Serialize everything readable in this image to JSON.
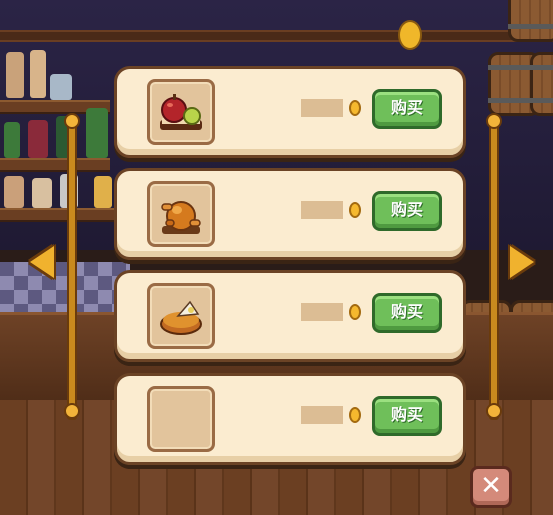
{
  "shop": {
    "items": [
      {
        "icon": "apple-basket-icon",
        "buy_label": "购买"
      },
      {
        "icon": "roast-chicken-icon",
        "buy_label": "购买"
      },
      {
        "icon": "pie-icon",
        "buy_label": "购买"
      },
      {
        "icon": "empty-slot-icon",
        "buy_label": "购买"
      }
    ],
    "close_label": "✕"
  },
  "colors": {
    "card_bg": "#fbecd0",
    "buy_button": "#6fbf5a",
    "coin": "#f5b82e",
    "rail": "#c98a1e"
  }
}
